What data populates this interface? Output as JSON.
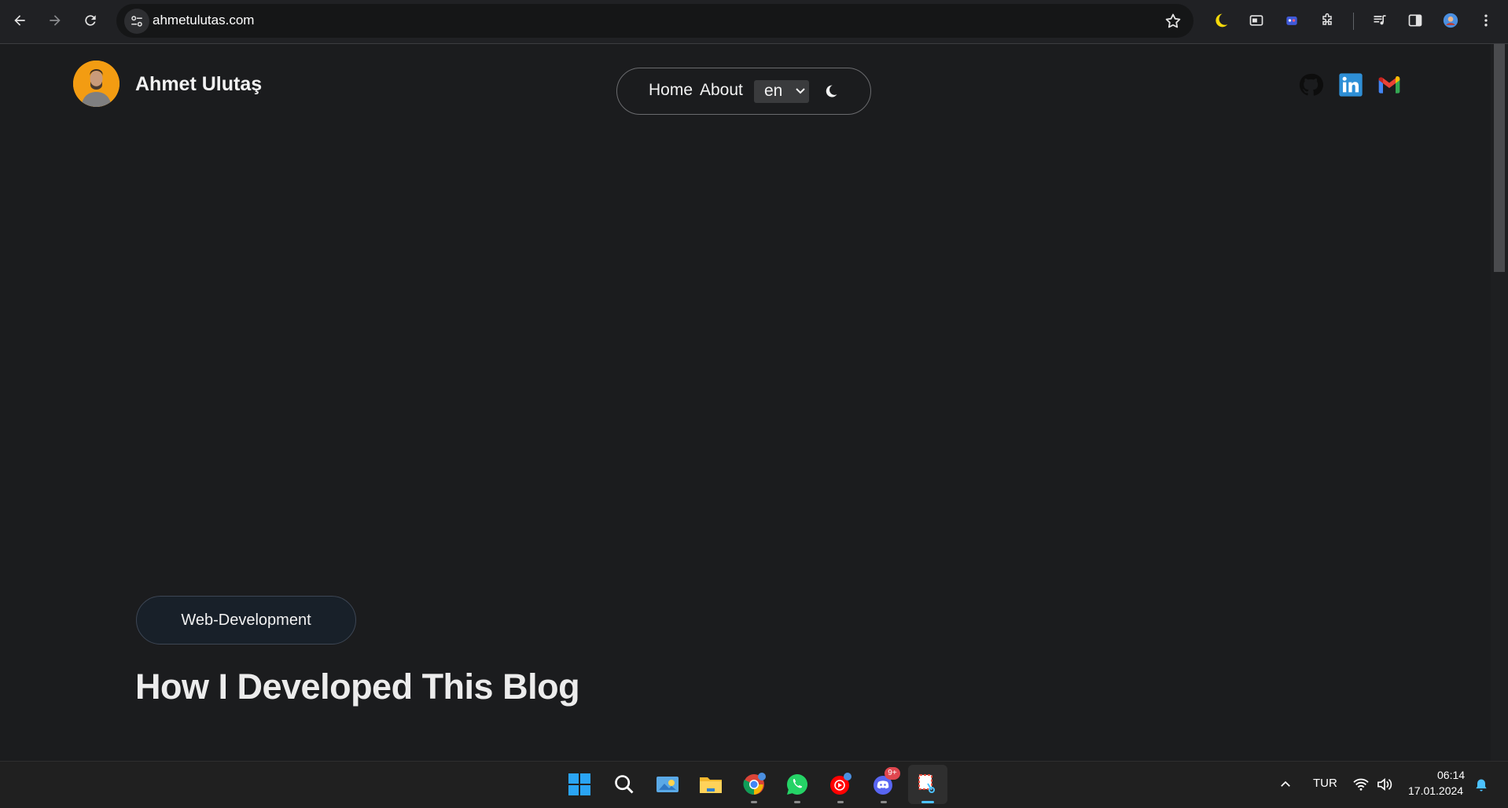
{
  "browser": {
    "url": "ahmetulutas.com",
    "accent_colors": {
      "moon": "#f5d90a",
      "taskbar_active": "#4cc2ff"
    }
  },
  "header": {
    "site_name": "Ahmet Ulutaş",
    "avatar_bg": "#f39c12"
  },
  "nav": {
    "home_label": "Home",
    "about_label": "About",
    "language_selected": "en"
  },
  "social": {
    "icons": [
      "github-icon",
      "linkedin-icon",
      "gmail-icon"
    ]
  },
  "post": {
    "category": "Web-Development",
    "title": "How I Developed This Blog"
  },
  "taskbar": {
    "discord_badge": "9+",
    "tray_language": "TUR",
    "time": "06:14",
    "date": "17.01.2024"
  }
}
